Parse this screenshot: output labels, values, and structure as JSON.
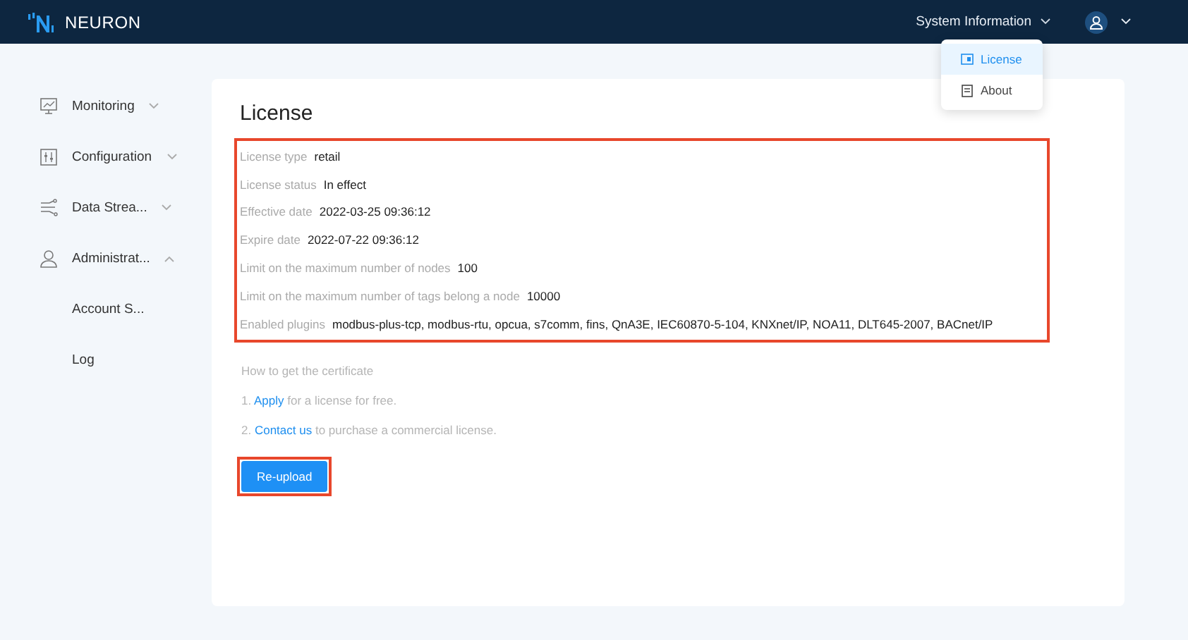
{
  "header": {
    "brand": "NEURON",
    "system_menu": "System Information"
  },
  "dropdown": {
    "items": [
      {
        "label": "License",
        "selected": true
      },
      {
        "label": "About",
        "selected": false
      }
    ]
  },
  "sidebar": {
    "items": [
      {
        "label": "Monitoring",
        "expanded": false
      },
      {
        "label": "Configuration",
        "expanded": false
      },
      {
        "label": "Data Strea...",
        "expanded": false
      },
      {
        "label": "Administrat...",
        "expanded": true,
        "children": [
          {
            "label": "Account S..."
          },
          {
            "label": "Log"
          }
        ]
      }
    ]
  },
  "license": {
    "title": "License",
    "highlighted": true,
    "fields": [
      {
        "label": "License type",
        "value": "retail"
      },
      {
        "label": "License status",
        "value": "In effect"
      },
      {
        "label": "Effective date",
        "value": "2022-03-25 09:36:12"
      },
      {
        "label": "Expire date",
        "value": "2022-07-22 09:36:12"
      },
      {
        "label": "Limit on the maximum number of nodes",
        "value": "100"
      },
      {
        "label": "Limit on the maximum number of tags belong a node",
        "value": "10000"
      },
      {
        "label": "Enabled plugins",
        "value": "modbus-plus-tcp, modbus-rtu, opcua, s7comm, fins, QnA3E, IEC60870-5-104, KNXnet/IP, NOA11, DLT645-2007, BACnet/IP"
      }
    ],
    "help": {
      "title": "How to get the certificate",
      "steps": [
        {
          "prefix": "1.",
          "link": "Apply",
          "suffix": "for a license for free."
        },
        {
          "prefix": "2.",
          "link": "Contact us",
          "suffix": "to purchase a commercial license."
        }
      ]
    },
    "button": {
      "label": "Re-upload",
      "highlighted": true
    }
  }
}
